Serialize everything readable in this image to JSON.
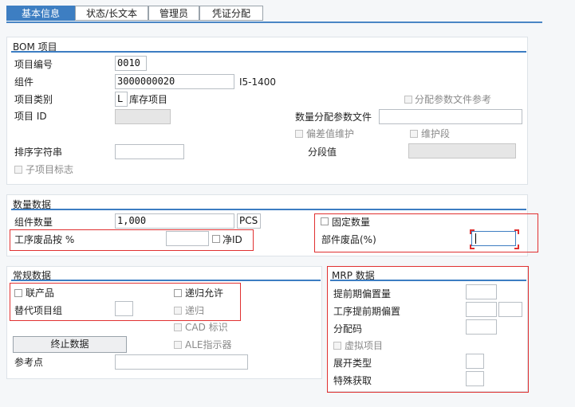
{
  "tabs": [
    "基本信息",
    "状态/长文本",
    "管理员",
    "凭证分配"
  ],
  "bom_item": {
    "title": "BOM 项目",
    "item_number_label": "项目编号",
    "item_number_value": "0010",
    "component_label": "组件",
    "component_value": "3000000020",
    "component_desc": "I5-1400",
    "item_category_label": "项目类别",
    "item_category_value": "L",
    "item_category_desc": "库存项目",
    "item_id_label": "项目 ID",
    "sort_string_label": "排序字符串",
    "sub_item_flag_label": "子项目标志",
    "dist_param_ref_label": "分配参数文件参考",
    "qty_dist_param_label": "数量分配参数文件",
    "deviation_maintain_label": "偏差值维护",
    "maintain_segment_label": "维护段",
    "segment_value_label": "分段值"
  },
  "quantity_data": {
    "title": "数量数据",
    "component_qty_label": "组件数量",
    "component_qty_value": "1,000",
    "unit_value": "PCS",
    "fixed_qty_label": "固定数量",
    "op_scrap_label": "工序废品按 %",
    "net_id_label": "净ID",
    "component_scrap_label": "部件废品(%)"
  },
  "general_data": {
    "title": "常规数据",
    "co_product_label": "联产品",
    "recursive_allowed_label": "递归允许",
    "alt_item_group_label": "替代项目组",
    "recursive_label": "递归",
    "cad_indicator_label": "CAD 标识",
    "ale_indicator_label": "ALE指示器",
    "end_data_button": "终止数据",
    "reference_point_label": "参考点"
  },
  "mrp_data": {
    "title": "MRP 数据",
    "lead_time_offset_label": "提前期偏置量",
    "op_lead_time_offset_label": "工序提前期偏置",
    "distribution_key_label": "分配码",
    "phantom_item_label": "虚拟项目",
    "explosion_type_label": "展开类型",
    "special_procurement_label": "特殊获取"
  },
  "colors": {
    "accent": "#3d7ec2",
    "highlight_box": "#e03030"
  }
}
